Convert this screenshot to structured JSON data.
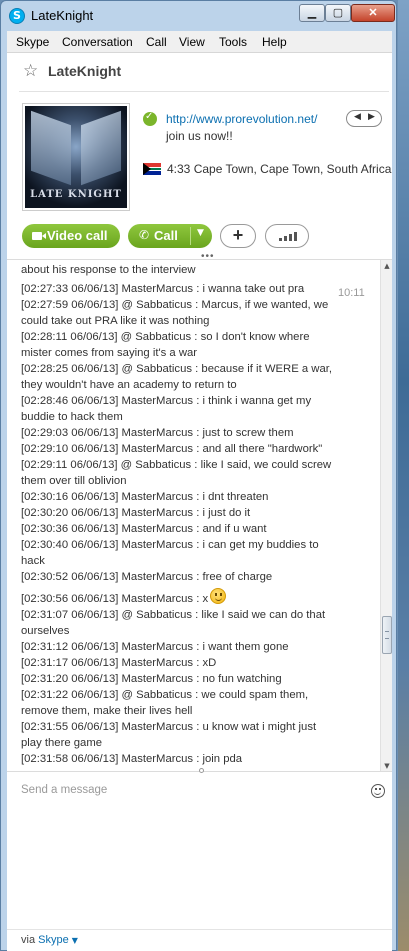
{
  "window": {
    "title": "LateKnight",
    "min_label": "▁",
    "max_label": "▢",
    "close_label": "✕"
  },
  "menu": [
    "Skype",
    "Conversation",
    "Call",
    "View",
    "Tools",
    "Help"
  ],
  "contact": {
    "name": "LateKnight",
    "avatar_text": "LATE KNIGHT",
    "mood_link": "http://www.prorevolution.net/",
    "mood_text": "join us now!!",
    "location": "4:33 Cape Town, Cape Town, South Africa"
  },
  "buttons": {
    "video_call": "Video call",
    "call": "Call",
    "add": "+"
  },
  "chat": {
    "time_marker": "10:11",
    "lines": [
      "about his response to the interview",
      "[02:27:33 06/06/13] MasterMarcus : i wanna take out pra",
      "[02:27:59 06/06/13] @ Sabbaticus : Marcus, if we wanted, we could take out PRA like it was nothing",
      "[02:28:11 06/06/13] @ Sabbaticus : so I don't know where mister comes from saying it's a war",
      "[02:28:25 06/06/13] @ Sabbaticus : because if it WERE a war, they wouldn't have an academy to return to",
      "[02:28:46 06/06/13] MasterMarcus : i think i wanna get my buddie to hack them",
      "[02:29:03 06/06/13] MasterMarcus : just to screw them",
      "[02:29:10 06/06/13] MasterMarcus : and all there \"hardwork\"",
      "[02:29:11 06/06/13] @ Sabbaticus : like I said, we could screw them over till oblivion",
      "[02:30:16 06/06/13] MasterMarcus : i dnt threaten",
      "[02:30:20 06/06/13] MasterMarcus : i just do it",
      "[02:30:36 06/06/13] MasterMarcus : and if u want",
      "[02:30:40 06/06/13] MasterMarcus : i can get my buddies to hack",
      "[02:30:52 06/06/13] MasterMarcus : free of charge",
      "[02:30:56 06/06/13] MasterMarcus : x",
      "[02:31:07 06/06/13] @ Sabbaticus : like I said we can do that ourselves",
      "[02:31:12 06/06/13] MasterMarcus : i want them gone",
      "[02:31:17 06/06/13] MasterMarcus : xD",
      "[02:31:20 06/06/13] MasterMarcus : no fun watching",
      "[02:31:22 06/06/13] @ Sabbaticus : we could spam them, remove them, make their lives hell",
      "[02:31:55 06/06/13] MasterMarcus : u know wat i might just play there game",
      "[02:31:58 06/06/13] MasterMarcus : join pda"
    ]
  },
  "compose": {
    "placeholder": "Send a message"
  },
  "footer": {
    "via": "via",
    "service": "Skype"
  }
}
